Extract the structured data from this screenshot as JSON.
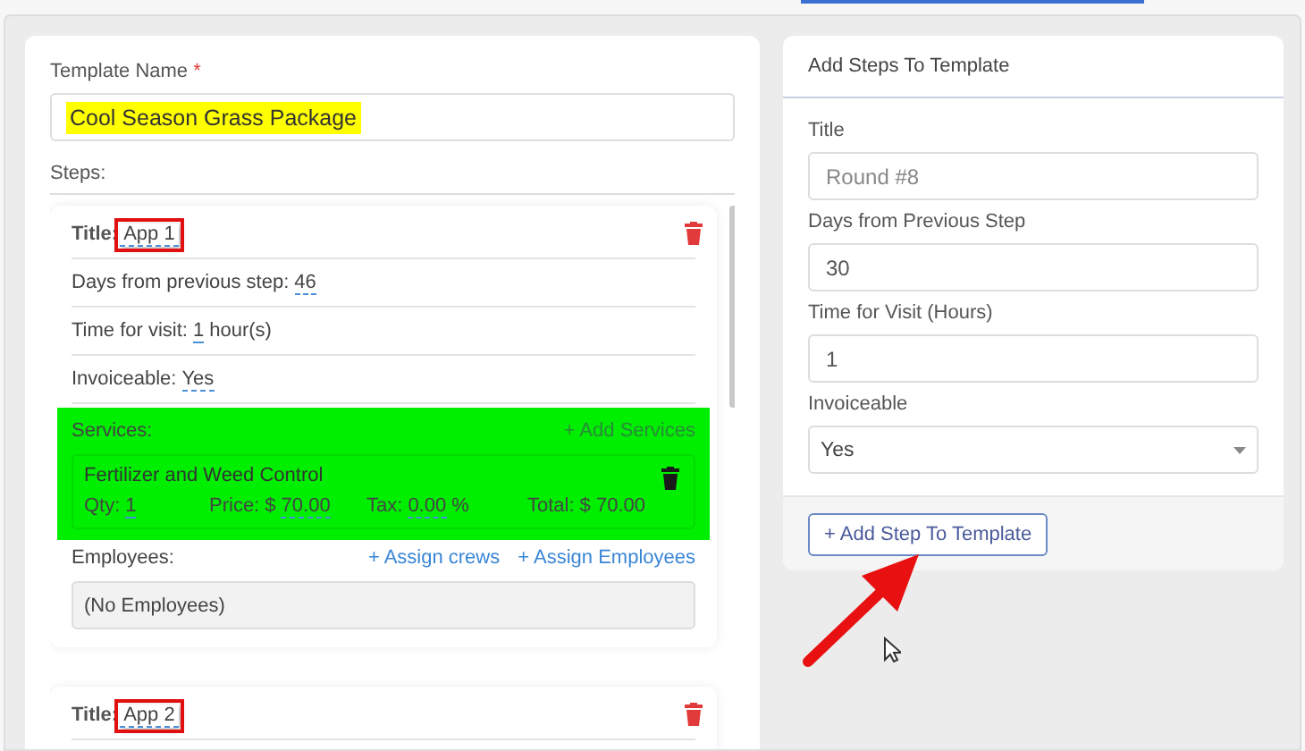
{
  "template_name": {
    "label": "Template Name",
    "required_mark": "*",
    "value": "Cool Season Grass Package",
    "highlighted": true
  },
  "steps_label": "Steps:",
  "steps": [
    {
      "title_label": "Title:",
      "title": "App 1",
      "outlined": true,
      "fields": [
        {
          "label": "Days from previous step:",
          "value": "46"
        },
        {
          "label": "Time for visit:",
          "value": "1",
          "unit": "hour(s)"
        },
        {
          "label": "Invoiceable:",
          "value": "Yes"
        }
      ],
      "services": {
        "label": "Services:",
        "add_link": "+ Add Services",
        "highlighted": true,
        "items": [
          {
            "name": "Fertilizer and Weed Control",
            "fields": [
              {
                "label": "Qty:",
                "value": "1",
                "editable": true
              },
              {
                "label": "Price: $",
                "value": "70.00",
                "editable": true
              },
              {
                "label": "Tax:",
                "value": "0.00",
                "unit": "%",
                "editable": true
              },
              {
                "label": "Total:",
                "value": "$ 70.00",
                "editable": false
              }
            ]
          }
        ]
      },
      "employees": {
        "label": "Employees:",
        "links": [
          "+ Assign crews",
          "+ Assign Employees"
        ],
        "empty_text": "(No Employees)"
      }
    },
    {
      "title_label": "Title:",
      "title": "App 2",
      "outlined": true
    }
  ],
  "add_steps": {
    "title": "Add Steps To Template",
    "fields": [
      {
        "label": "Title",
        "kind": "input",
        "placeholder": "Round #8"
      },
      {
        "label": "Days from Previous Step",
        "kind": "input",
        "value": "30"
      },
      {
        "label": "Time for Visit (Hours)",
        "kind": "input",
        "value": "1"
      },
      {
        "label": "Invoiceable",
        "kind": "select",
        "value": "Yes"
      }
    ],
    "button": "+ Add Step To Template"
  }
}
